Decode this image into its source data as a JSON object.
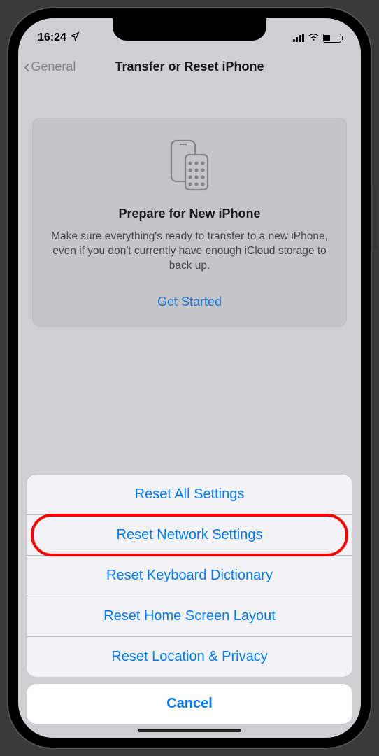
{
  "status": {
    "time": "16:24",
    "location_icon": "location-arrow"
  },
  "nav": {
    "back_label": "General",
    "title": "Transfer or Reset iPhone"
  },
  "prepare_card": {
    "title": "Prepare for New iPhone",
    "description": "Make sure everything's ready to transfer to a new iPhone, even if you don't currently have enough iCloud storage to back up.",
    "action_label": "Get Started"
  },
  "action_sheet": {
    "items": [
      {
        "label": "Reset All Settings"
      },
      {
        "label": "Reset Network Settings",
        "highlighted": true
      },
      {
        "label": "Reset Keyboard Dictionary"
      },
      {
        "label": "Reset Home Screen Layout"
      },
      {
        "label": "Reset Location & Privacy"
      }
    ],
    "cancel_label": "Cancel"
  }
}
